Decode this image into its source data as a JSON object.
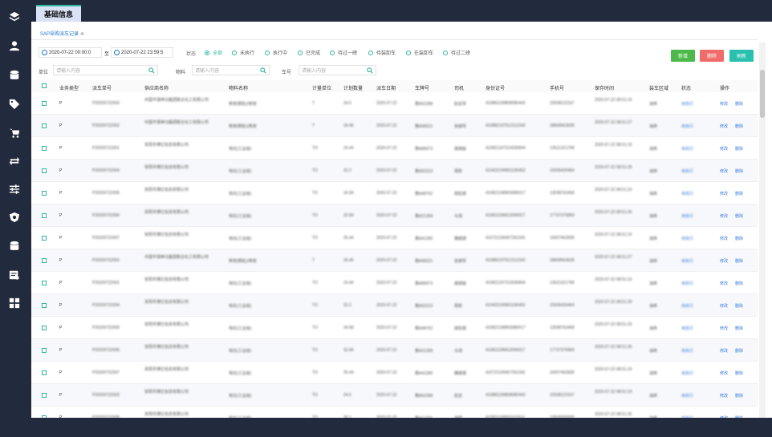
{
  "sidebar": {
    "items": [
      {
        "name": "layers-icon"
      },
      {
        "name": "user-icon"
      },
      {
        "name": "database-icon"
      },
      {
        "name": "tag-icon"
      },
      {
        "name": "cart-icon"
      },
      {
        "name": "exchange-icon"
      },
      {
        "name": "sliders-icon"
      },
      {
        "name": "shield-icon"
      },
      {
        "name": "database-icon-2"
      },
      {
        "name": "report-icon"
      },
      {
        "name": "apps-icon"
      }
    ]
  },
  "header": {
    "tab_label": "基础信息"
  },
  "breadcrumb": {
    "label": "SAP采购派车记录",
    "close": "⊗"
  },
  "filters": {
    "date_start": "2020-07-22 00:00:0",
    "date_sep": "至",
    "date_end": "2020-07-22 23:59:5",
    "status_label": "状态",
    "status_options": [
      {
        "label": "全部",
        "checked": true
      },
      {
        "label": "未执行",
        "checked": false
      },
      {
        "label": "执行中",
        "checked": false
      },
      {
        "label": "已完成",
        "checked": false
      },
      {
        "label": "待过一磅",
        "checked": false
      },
      {
        "label": "待装卸车",
        "checked": false
      },
      {
        "label": "在装卸车",
        "checked": false
      },
      {
        "label": "待过二磅",
        "checked": false
      }
    ],
    "unit_label": "单位",
    "unit_placeholder": "请输入内容",
    "material_label": "物料",
    "material_placeholder": "请输入内容",
    "vehicle_label": "车号",
    "vehicle_placeholder": "请输入内容"
  },
  "toolbar": {
    "add_label": "新增",
    "delete_label": "删除",
    "refresh_label": "刷新"
  },
  "table": {
    "columns": [
      "业务类型",
      "派车单号",
      "供应商名称",
      "物料名称",
      "计量单位",
      "计划数量",
      "派车日期",
      "车牌号",
      "司机",
      "身份证号",
      "手机号",
      "保存时间",
      "装车区域",
      "状态",
      "操作"
    ],
    "rows": [
      {
        "type": "P",
        "order": "P20200722003",
        "supplier": "中国平煤神马集团联合化工有限公司",
        "material": "焦炭(颗粒)/焦炭",
        "unit": "T",
        "qty": "34.5",
        "date": "2020-07-22",
        "plate": "豫A62288",
        "driver": "赵亚军",
        "id_no": "410881199808080442",
        "phone": "15938123167",
        "saved": "2020-07-22 08:51:19",
        "area": "油库",
        "status": "未执行",
        "edit": "修改",
        "del": "删除"
      },
      {
        "type": "P",
        "order": "P20200722002",
        "supplier": "中国平煤神马集团联合化工有限公司",
        "material": "焦炭(颗粒)/焦炭",
        "unit": "T",
        "qty": "34.46",
        "date": "2020-07-22",
        "plate": "豫A96521",
        "driver": "张继军",
        "id_no": "410882197512112342",
        "phone": "18669563628",
        "saved": "2020-07-22 08:51:27",
        "area": "油库",
        "status": "未执行",
        "edit": "修改",
        "del": "删除"
      },
      {
        "type": "P",
        "order": "P20200722001",
        "supplier": "安阳市博亿信息有限公司",
        "material": "电石(工业级)",
        "unit": "TO",
        "qty": "24.44",
        "date": "2020-07-22",
        "plate": "豫A86973",
        "driver": "谢继能",
        "id_no": "410821197210030844",
        "phone": "13521321768",
        "saved": "2020-07-22 08:51:19",
        "area": "油库",
        "status": "未执行",
        "edit": "修改",
        "del": "删除"
      },
      {
        "type": "P",
        "order": "P20200722004",
        "supplier": "安阳市博亿信息有限公司",
        "material": "电石(工业级)",
        "unit": "TO",
        "qty": "32.2",
        "date": "2020-07-22",
        "plate": "豫A92223",
        "driver": "周新",
        "id_no": "410422199901190452",
        "phone": "15935426464",
        "saved": "2020-07-22 08:51:29",
        "area": "油库",
        "status": "未执行",
        "edit": "修改",
        "del": "删除"
      },
      {
        "type": "P",
        "order": "P20200722005",
        "supplier": "安阳市博亿信息有限公司",
        "material": "电石(工业级)",
        "unit": "TO",
        "qty": "34.58",
        "date": "2020-07-22",
        "plate": "豫A48762",
        "driver": "胡宏斌",
        "id_no": "410821198903080017",
        "phone": "13598763458",
        "saved": "2020-07-22 08:51:23",
        "area": "油库",
        "status": "未执行",
        "edit": "修改",
        "del": "删除"
      },
      {
        "type": "P",
        "order": "P20200722006",
        "supplier": "安阳市博亿信息有限公司",
        "material": "电石(工业级)",
        "unit": "TO",
        "qty": "32.84",
        "date": "2020-07-22",
        "plate": "豫A21358",
        "driver": "马涛",
        "id_no": "410811196812090017",
        "phone": "17737376969",
        "saved": "2020-07-22 08:51:26",
        "area": "油库",
        "status": "未执行",
        "edit": "修改",
        "del": "删除"
      },
      {
        "type": "P",
        "order": "P20200722007",
        "supplier": "安阳市博亿信息有限公司",
        "material": "电石(工业级)",
        "unit": "TO",
        "qty": "25.44",
        "date": "2020-07-22",
        "plate": "豫A41280",
        "driver": "魏斌德",
        "id_no": "410721199407262341",
        "phone": "15007462828",
        "saved": "2020-07-22 08:51:19",
        "area": "油库",
        "status": "未执行",
        "edit": "修改",
        "del": "删除"
      },
      {
        "type": "P",
        "order": "P20200722002",
        "supplier": "中国平煤神马集团联合化工有限公司",
        "material": "焦炭(颗粒)/焦炭",
        "unit": "T",
        "qty": "34.46",
        "date": "2020-07-22",
        "plate": "豫A96521",
        "driver": "张继军",
        "id_no": "410882197512112342",
        "phone": "18669563628",
        "saved": "2020-07-22 08:51:27",
        "area": "油库",
        "status": "未执行",
        "edit": "修改",
        "del": "删除"
      },
      {
        "type": "P",
        "order": "P20200722001",
        "supplier": "安阳市博亿信息有限公司",
        "material": "电石(工业级)",
        "unit": "TO",
        "qty": "24.44",
        "date": "2020-07-22",
        "plate": "豫A86973",
        "driver": "谢继能",
        "id_no": "410821197210030844",
        "phone": "13521321768",
        "saved": "2020-07-22 08:51:19",
        "area": "油库",
        "status": "未执行",
        "edit": "修改",
        "del": "删除"
      },
      {
        "type": "P",
        "order": "P20200722004",
        "supplier": "安阳市博亿信息有限公司",
        "material": "电石(工业级)",
        "unit": "TO",
        "qty": "32.2",
        "date": "2020-07-22",
        "plate": "豫A92223",
        "driver": "周新",
        "id_no": "410422199901190452",
        "phone": "15935426464",
        "saved": "2020-07-22 08:51:29",
        "area": "油库",
        "status": "未执行",
        "edit": "修改",
        "del": "删除"
      },
      {
        "type": "P",
        "order": "P20200722005",
        "supplier": "安阳市博亿信息有限公司",
        "material": "电石(工业级)",
        "unit": "TO",
        "qty": "34.58",
        "date": "2020-07-22",
        "plate": "豫A48762",
        "driver": "胡宏斌",
        "id_no": "410821198903080017",
        "phone": "13598763458",
        "saved": "2020-07-22 08:51:23",
        "area": "油库",
        "status": "未执行",
        "edit": "修改",
        "del": "删除"
      },
      {
        "type": "P",
        "order": "P20200722006",
        "supplier": "安阳市博亿信息有限公司",
        "material": "电石(工业级)",
        "unit": "TO",
        "qty": "32.84",
        "date": "2020-07-22",
        "plate": "豫A21358",
        "driver": "马涛",
        "id_no": "410811196812090017",
        "phone": "17737376969",
        "saved": "2020-07-22 08:51:26",
        "area": "油库",
        "status": "未执行",
        "edit": "修改",
        "del": "删除"
      },
      {
        "type": "P",
        "order": "P20200722007",
        "supplier": "安阳市博亿信息有限公司",
        "material": "电石(工业级)",
        "unit": "TO",
        "qty": "25.44",
        "date": "2020-07-22",
        "plate": "豫A41280",
        "driver": "魏斌德",
        "id_no": "410721199407262341",
        "phone": "15007462828",
        "saved": "2020-07-22 08:51:19",
        "area": "油库",
        "status": "未执行",
        "edit": "修改",
        "del": "删除"
      },
      {
        "type": "P",
        "order": "P20200722003",
        "supplier": "安阳市博亿信息有限公司",
        "material": "电石(工业级)",
        "unit": "TO",
        "qty": "34.5",
        "date": "2020-07-22",
        "plate": "豫A62288",
        "driver": "赵亚",
        "id_no": "410881199808080442",
        "phone": "15938123167",
        "saved": "2020-07-22 08:51:19",
        "area": "油库",
        "status": "未执行",
        "edit": "修改",
        "del": "删除"
      },
      {
        "type": "P",
        "order": "P20200722008",
        "supplier": "安阳市博亿信息有限公司",
        "material": "电石(工业级)",
        "unit": "TO",
        "qty": "30.1",
        "date": "2020-07-22",
        "plate": "豫A11256",
        "driver": "李明",
        "id_no": "410821199001010011",
        "phone": "13500000000",
        "saved": "2020-07-22 08:51:20",
        "area": "油库",
        "status": "未执行",
        "edit": "修改",
        "del": "删除"
      }
    ]
  },
  "colors": {
    "accent": "#2fb3a0",
    "sidebar": "#222a3d",
    "link": "#3b7bd9"
  }
}
